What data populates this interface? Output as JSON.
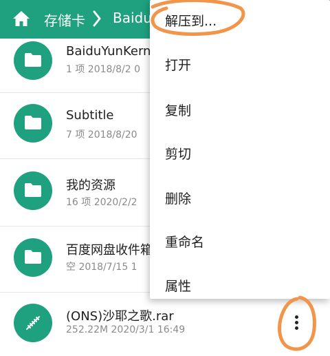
{
  "header": {
    "home_icon": "home-icon",
    "breadcrumb": [
      "存储卡",
      "Baidu"
    ]
  },
  "files": [
    {
      "name": "BaiduYunKern",
      "meta": "1 项  2018/8/2 0",
      "icon": "folder-icon"
    },
    {
      "name": "Subtitle",
      "meta": "7 项  2018/8/20",
      "icon": "folder-icon"
    },
    {
      "name": "我的资源",
      "meta": "16 项  2020/2/2",
      "icon": "folder-icon"
    },
    {
      "name": "百度网盘收件箱",
      "meta": "空  2018/7/15 1",
      "icon": "folder-icon"
    },
    {
      "name": "(ONS)沙耶之歌.rar",
      "meta": "252.22M  2020/3/1 16:49",
      "icon": "archive-icon"
    }
  ],
  "context_menu": {
    "items": [
      "解压到...",
      "打开",
      "复制",
      "剪切",
      "删除",
      "重命名",
      "属性"
    ]
  },
  "more_button_icon": "more-vert-icon",
  "colors": {
    "accent": "#1fa17f",
    "annotation": "#f0954a"
  }
}
